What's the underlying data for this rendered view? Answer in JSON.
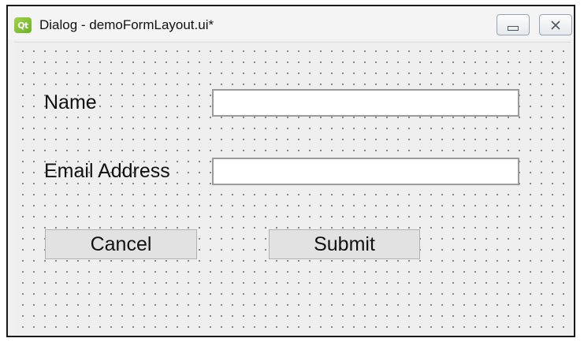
{
  "window": {
    "title": "Dialog - demoFormLayout.ui*",
    "app_icon_text": "Qt",
    "minimize_glyph": "minimize-icon",
    "close_glyph": "✕"
  },
  "form": {
    "name_label": "Name",
    "name_value": "",
    "email_label": "Email Address",
    "email_value": "",
    "cancel_label": "Cancel",
    "submit_label": "Submit"
  },
  "icons": {
    "app": "qt-designer-icon",
    "minimize": "minimize-icon",
    "close": "close-icon"
  },
  "colors": {
    "app_icon": "#7fc23a",
    "canvas": "#efefef",
    "grid_dots": "#7c7c7c"
  }
}
